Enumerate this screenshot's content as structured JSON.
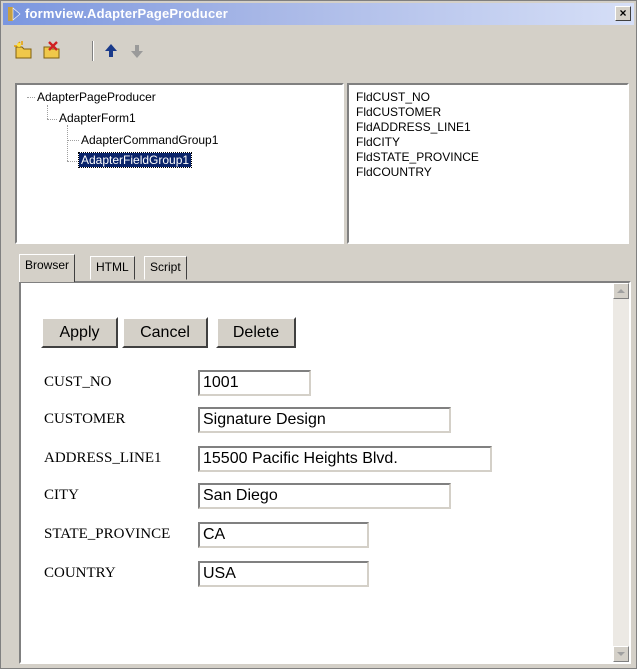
{
  "window": {
    "title": "formview.AdapterPageProducer",
    "close_glyph": "×"
  },
  "toolbar": {
    "buttons": [
      "new-item-icon",
      "delete-item-icon",
      "move-up-icon",
      "move-down-icon"
    ]
  },
  "tree": {
    "items": [
      {
        "label": "AdapterPageProducer",
        "selected": false
      },
      {
        "label": "AdapterForm1",
        "selected": false
      },
      {
        "label": "AdapterCommandGroup1",
        "selected": false
      },
      {
        "label": "AdapterFieldGroup1",
        "selected": true
      }
    ]
  },
  "fields": {
    "items": [
      "FldCUST_NO",
      "FldCUSTOMER",
      "FldADDRESS_LINE1",
      "FldCITY",
      "FldSTATE_PROVINCE",
      "FldCOUNTRY"
    ]
  },
  "tabs": [
    {
      "label": "Browser",
      "active": true
    },
    {
      "label": "HTML",
      "active": false
    },
    {
      "label": "Script",
      "active": false
    }
  ],
  "form": {
    "buttons": {
      "apply": "Apply",
      "cancel": "Cancel",
      "delete": "Delete"
    },
    "rows": [
      {
        "label": "CUST_NO",
        "value": "1001"
      },
      {
        "label": "CUSTOMER",
        "value": "Signature Design"
      },
      {
        "label": "ADDRESS_LINE1",
        "value": "15500 Pacific Heights Blvd."
      },
      {
        "label": "CITY",
        "value": "San Diego"
      },
      {
        "label": "STATE_PROVINCE",
        "value": "CA"
      },
      {
        "label": "COUNTRY",
        "value": "USA"
      }
    ]
  },
  "colors": {
    "face": "#d4d0c8",
    "selection": "#0a246a",
    "title_gradient_start": "#7a96df"
  }
}
